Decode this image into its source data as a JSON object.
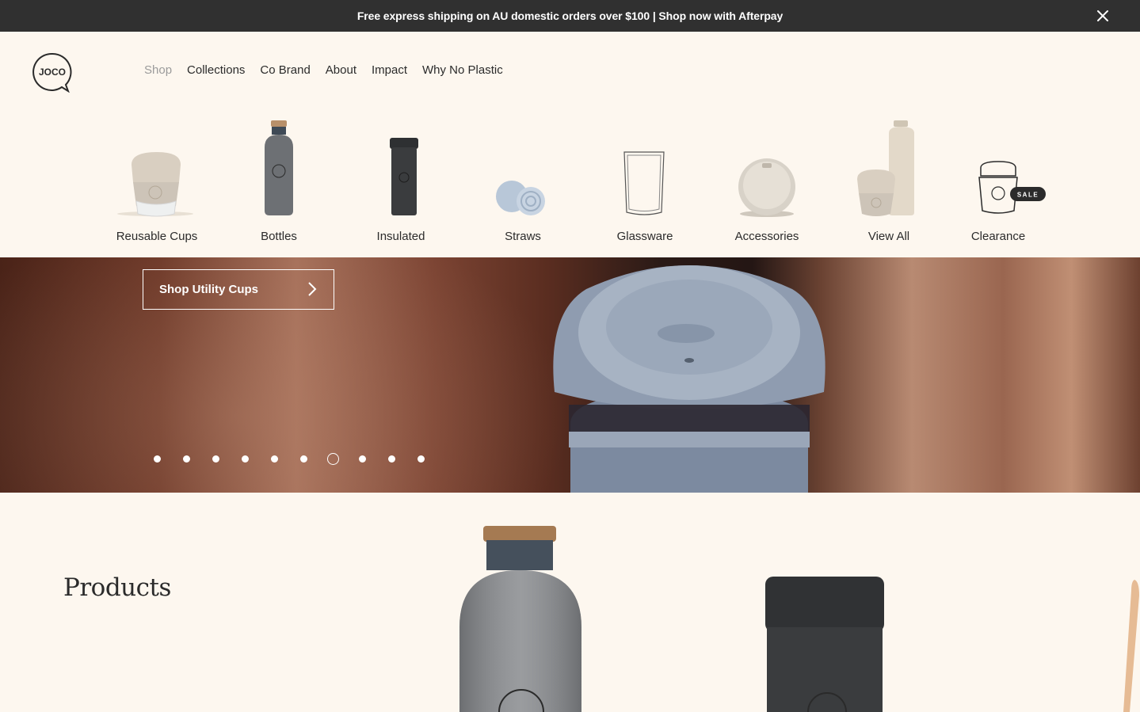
{
  "announcement": {
    "text": "Free express shipping on AU domestic orders over $100 | Shop now with Afterpay"
  },
  "logo": {
    "text": "JOCO"
  },
  "nav": {
    "items": [
      {
        "label": "Shop",
        "active": true
      },
      {
        "label": "Collections"
      },
      {
        "label": "Co Brand"
      },
      {
        "label": "About"
      },
      {
        "label": "Impact"
      },
      {
        "label": "Why No Plastic"
      }
    ]
  },
  "categories": [
    {
      "label": "Reusable Cups"
    },
    {
      "label": "Bottles"
    },
    {
      "label": "Insulated"
    },
    {
      "label": "Straws"
    },
    {
      "label": "Glassware"
    },
    {
      "label": "Accessories"
    },
    {
      "label": "View All"
    },
    {
      "label": "Clearance",
      "badge": "SALE"
    }
  ],
  "hero": {
    "button_label": "Shop Utility Cups",
    "slide_count": 10,
    "active_slide": 7
  },
  "products": {
    "heading": "Products"
  },
  "colors": {
    "announcement_bg": "#303030",
    "page_bg": "#fdf7ef",
    "nav_active": "#9b9b9b",
    "text": "#2b2b2b"
  }
}
